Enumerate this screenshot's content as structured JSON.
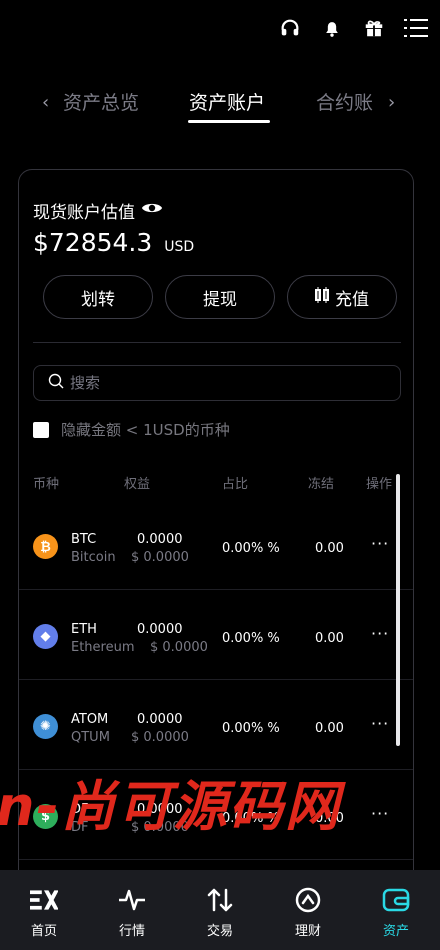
{
  "topbar": {
    "icons": [
      "headset-icon",
      "bell-icon",
      "gift-icon",
      "menu-icon"
    ]
  },
  "tabs": {
    "prev": "资产总览",
    "active": "资产账户",
    "next": "合约账"
  },
  "account": {
    "estimate_label": "现货账户估值",
    "amount": "$72854.3",
    "currency": "USD"
  },
  "actions": {
    "transfer": "划转",
    "withdraw": "提现",
    "deposit": "充值"
  },
  "search": {
    "placeholder": "搜索"
  },
  "hide_small": {
    "label": "隐藏金额 < 1USD的币种",
    "checked": false
  },
  "table": {
    "headers": {
      "coin": "币种",
      "equity": "权益",
      "ratio": "占比",
      "frozen": "冻结",
      "action": "操作"
    },
    "rows": [
      {
        "symbol": "BTC",
        "name": "Bitcoin",
        "equity": "0.0000",
        "equity_usd": "$ 0.0000",
        "ratio": "0.00% %",
        "frozen": "0.00",
        "more": "···",
        "color": "#f7931a",
        "icon": "bitcoin-icon"
      },
      {
        "symbol": "ETH",
        "name": "Ethereum",
        "equity": "0.0000",
        "equity_usd": "$ 0.0000",
        "ratio": "0.00% %",
        "frozen": "0.00",
        "more": "···",
        "color": "#627eea",
        "icon": "ethereum-icon"
      },
      {
        "symbol": "ATOM",
        "name": "QTUM",
        "equity": "0.0000",
        "equity_usd": "$ 0.0000",
        "ratio": "0.00% %",
        "frozen": "0.00",
        "more": "···",
        "color": "#3f8fd6",
        "icon": "atom-icon"
      },
      {
        "symbol": "DF",
        "name": "DF",
        "equity": "0.0000",
        "equity_usd": "$ 0.0000",
        "ratio": "0.00% %",
        "frozen": "0.00",
        "more": "···",
        "color": "#2eae5c",
        "icon": "df-icon"
      }
    ]
  },
  "watermark": "n-尚可源码网",
  "bottom_nav": [
    {
      "label": "首页",
      "icon": "home-logo-icon",
      "active": false
    },
    {
      "label": "行情",
      "icon": "pulse-icon",
      "active": false
    },
    {
      "label": "交易",
      "icon": "swap-arrows-icon",
      "active": false
    },
    {
      "label": "理财",
      "icon": "finance-icon",
      "active": false
    },
    {
      "label": "资产",
      "icon": "wallet-icon",
      "active": true
    }
  ]
}
